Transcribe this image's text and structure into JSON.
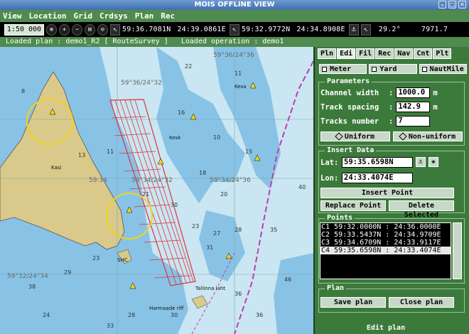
{
  "window": {
    "title": "MOIS OFFLINE VIEW"
  },
  "menu": [
    "View",
    "Location",
    "Grid",
    "Crdsys",
    "Plan",
    "Rec"
  ],
  "toolbar": {
    "scale": "1:50 000",
    "cursor_lat": "59:36.7081N",
    "cursor_lon": "24:39.0861E",
    "ref_lat": "59:32.9772N",
    "ref_lon": "24:34.8908E",
    "bearing": "29.2°",
    "distance": "7971.7"
  },
  "status": {
    "loaded_plan_label": "Loaded plan :",
    "loaded_plan": "demo1_R2 [ RouteSurvey ]",
    "loaded_operation_label": "Loaded operation :",
    "loaded_operation": "demo1"
  },
  "tabs": [
    "Pln",
    "Edi",
    "Fil",
    "Rec",
    "Nav",
    "Cnt",
    "Plt"
  ],
  "units": [
    "Meter",
    "Yard",
    "NautMile"
  ],
  "parameters": {
    "title": "Parameters",
    "channel_width_label": "Channel width",
    "channel_width": "1000.0",
    "channel_width_unit": "m",
    "track_spacing_label": "Track spacing",
    "track_spacing": "142.9",
    "track_spacing_unit": "m",
    "tracks_number_label": "Tracks number",
    "tracks_number": "7",
    "uniform": "Uniform",
    "non_uniform": "Non-uniform"
  },
  "insert": {
    "title": "Insert Data",
    "lat_label": "Lat:",
    "lat": "59:35.6598N",
    "lon_label": "Lon:",
    "lon": "24:33.4074E",
    "insert_point": "Insert Point",
    "replace_point": "Replace Point",
    "delete_selected": "Delete Selected"
  },
  "points": {
    "title": "Points",
    "items": [
      "C1 59:32.0000N : 24:36.0000E",
      "C2 59:33.5437N : 24:34.9709E",
      "C3 59:34.6709N : 24:33.9117E",
      "C4 59:35.6598N : 24:33.4074E"
    ],
    "selected_index": 3
  },
  "plan": {
    "title": "Plan",
    "save": "Save plan",
    "close": "Close plan",
    "edit": "Edit plan"
  },
  "map": {
    "labels": [
      "59°36/24°32",
      "59°36/24°36",
      "59°34/24°36",
      "59°34/24°32",
      "59°32/24°34",
      "59:34",
      "Kasi",
      "Kesa",
      "Kesk",
      "Taliinna laht",
      "Harmaade riff",
      "SHC"
    ],
    "soundings": [
      "8",
      "13",
      "11",
      "22",
      "11",
      "16",
      "10",
      "15",
      "18",
      "20",
      "38",
      "29",
      "23",
      "24",
      "28",
      "30",
      "33",
      "36",
      "35",
      "40",
      "46",
      "36",
      "23",
      "27",
      "28",
      "31",
      "30",
      "21"
    ]
  },
  "colors": {
    "land": "#d9c98a",
    "shallow": "#88c3e6",
    "deep": "#c9e6f2",
    "track": "#e0303a",
    "panel": "#3c7a3c"
  }
}
